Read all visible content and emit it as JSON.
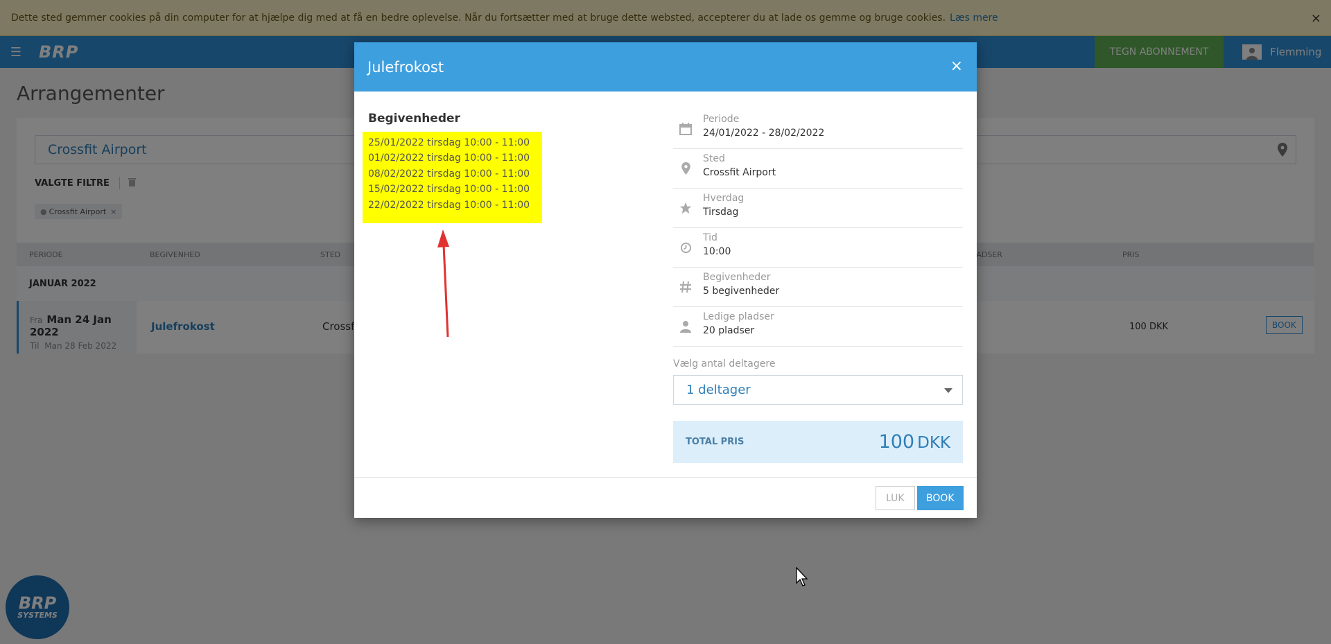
{
  "cookie": {
    "text": "Dette sted gemmer cookies på din computer for at hjælpe dig med at få en bedre oplevelse. Når du fortsætter med at bruge dette websted, accepterer du at lade os gemme og bruge cookies.",
    "link": "Læs mere",
    "close": "×"
  },
  "nav": {
    "logo": "BRP",
    "subscribe": "TEGN ABONNEMENT",
    "user": "Flemming"
  },
  "page": {
    "title": "Arrangementer",
    "search_value": "Crossfit Airport",
    "filters_label": "VALGTE FILTRE",
    "chip": "Crossfit Airport",
    "chip_remove": "×"
  },
  "table": {
    "headers": [
      "PERIODE",
      "BEGIVENHED",
      "STED",
      "LADSER",
      "PRIS"
    ],
    "month": "JANUAR 2022",
    "row": {
      "fra_label": "Fra",
      "fra_date": "Man 24 Jan 2022",
      "til_label": "Til",
      "til_date": "Man 28 Feb 2022",
      "name": "Julefrokost",
      "place": "Crossfit",
      "price": "100 DKK",
      "book": "BOOK"
    }
  },
  "badge": {
    "line1": "BRP",
    "line2": "SYSTEMS"
  },
  "modal": {
    "title": "Julefrokost",
    "close": "×",
    "events_title": "Begivenheder",
    "events": [
      "25/01/2022 tirsdag 10:00 - 11:00",
      "01/02/2022 tirsdag 10:00 - 11:00",
      "08/02/2022 tirsdag 10:00 - 11:00",
      "15/02/2022 tirsdag 10:00 - 11:00",
      "22/02/2022 tirsdag 10:00 - 11:00"
    ],
    "info": [
      {
        "icon": "calendar-icon",
        "label": "Periode",
        "value": "24/01/2022 - 28/02/2022"
      },
      {
        "icon": "map-pin-icon",
        "label": "Sted",
        "value": "Crossfit Airport"
      },
      {
        "icon": "star-icon",
        "label": "Hverdag",
        "value": "Tirsdag"
      },
      {
        "icon": "clock-icon",
        "label": "Tid",
        "value": "10:00"
      },
      {
        "icon": "hash-icon",
        "label": "Begivenheder",
        "value": "5 begivenheder"
      },
      {
        "icon": "person-icon",
        "label": "Ledige pladser",
        "value": "20 pladser"
      }
    ],
    "qty_label": "Vælg antal deltagere",
    "qty_value": "1 deltager",
    "total_label": "TOTAL PRIS",
    "total_amount": "100",
    "total_currency": "DKK",
    "btn_close": "LUK",
    "btn_book": "BOOK"
  },
  "colors": {
    "primary": "#3e9fdf",
    "subscribe_green": "#5fae52",
    "highlight_yellow": "#ffff00",
    "arrow_red": "#e0322f"
  }
}
